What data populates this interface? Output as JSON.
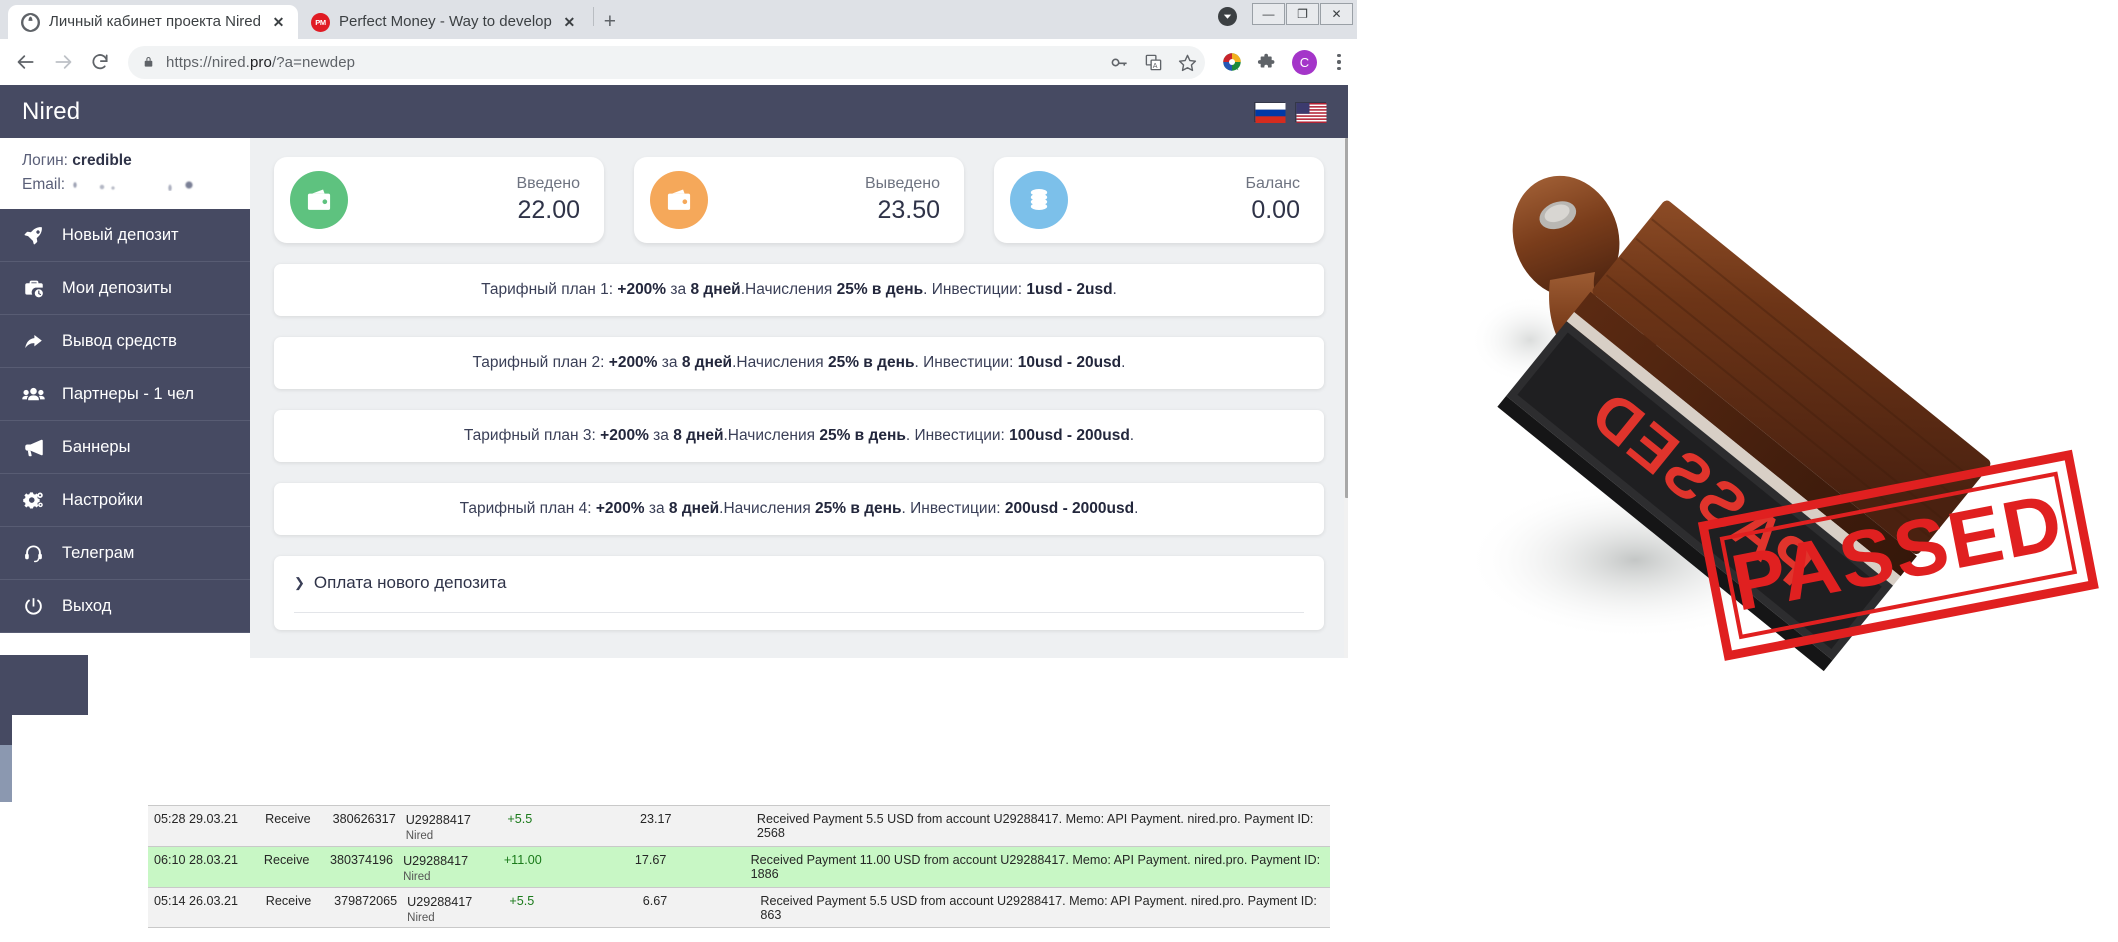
{
  "browser": {
    "tabs": [
      {
        "title": "Личный кабинет проекта Nired",
        "favicon": "globe-icon",
        "active": true,
        "close_label": "✕"
      },
      {
        "title": "Perfect Money - Way to develop",
        "favicon": "perfect-money-icon",
        "active": false,
        "close_label": "✕"
      }
    ],
    "new_tab_label": "+",
    "window_controls": {
      "minimize": "—",
      "maximize": "❐",
      "close": "✕"
    },
    "address": {
      "url_prefix": "https://nired.",
      "url_domain": "pro",
      "url_suffix": "/?a=newdep",
      "full_url": "https://nired.pro/?a=newdep",
      "lock": "lock-icon"
    },
    "nav": {
      "back": "back-arrow-icon",
      "forward": "forward-arrow-icon",
      "reload": "reload-icon"
    },
    "omni_icons": [
      "password-key-icon",
      "translate-icon",
      "bookmark-star-icon"
    ],
    "extensions": [
      "imgburn-icon",
      "puzzle-extensions-icon"
    ],
    "profile_initial": "C",
    "menu": "kebab-menu-icon"
  },
  "site": {
    "brand": "Nired",
    "languages": [
      {
        "name": "russian-flag",
        "code": "ru"
      },
      {
        "name": "us-flag",
        "code": "en"
      }
    ],
    "accent_dark": "#464a62",
    "accent_bg": "#eef0f2"
  },
  "sidebar": {
    "login_label": "Логин:",
    "login_value": "credible",
    "email_label": "Email:",
    "email_value": "",
    "items": [
      {
        "label": "Новый депозит",
        "icon": "rocket-icon"
      },
      {
        "label": "Мои депозиты",
        "icon": "briefcase-clock-icon"
      },
      {
        "label": "Вывод средств",
        "icon": "share-arrow-icon"
      },
      {
        "label": "Партнеры - 1 чел",
        "icon": "users-group-icon"
      },
      {
        "label": "Баннеры",
        "icon": "megaphone-icon"
      },
      {
        "label": "Настройки",
        "icon": "gears-icon"
      },
      {
        "label": "Телеграм",
        "icon": "headset-icon"
      },
      {
        "label": "Выход",
        "icon": "power-icon"
      }
    ]
  },
  "stats": [
    {
      "label": "Введено",
      "value": "22.00",
      "icon": "wallet-in-icon",
      "color": "#5ec27f"
    },
    {
      "label": "Выведено",
      "value": "23.50",
      "icon": "wallet-out-icon",
      "color": "#f5a85a"
    },
    {
      "label": "Баланс",
      "value": "0.00",
      "icon": "coins-icon",
      "color": "#7cc0ea"
    }
  ],
  "plans": [
    {
      "prefix": "Тарифный план 1: ",
      "percent": "+200%",
      "mid1": " за ",
      "days": "8 дней",
      "mid2": ".Начисления ",
      "rate": "25% в день",
      "mid3": ". Инвестиции: ",
      "range": "1usd - 2usd",
      "end": "."
    },
    {
      "prefix": "Тарифный план 2: ",
      "percent": "+200%",
      "mid1": " за ",
      "days": "8 дней",
      "mid2": ".Начисления ",
      "rate": "25% в день",
      "mid3": ". Инвестиции: ",
      "range": "10usd - 20usd",
      "end": "."
    },
    {
      "prefix": "Тарифный план 3: ",
      "percent": "+200%",
      "mid1": " за ",
      "days": "8 дней",
      "mid2": ".Начисления ",
      "rate": "25% в день",
      "mid3": ". Инвестиции: ",
      "range": "100usd - 200usd",
      "end": "."
    },
    {
      "prefix": "Тарифный план 4: ",
      "percent": "+200%",
      "mid1": " за ",
      "days": "8 дней",
      "mid2": ".Начисления ",
      "rate": "25% в день",
      "mid3": ". Инвестиции: ",
      "range": "200usd - 2000usd",
      "end": "."
    }
  ],
  "accordion": {
    "caret": "❯",
    "title": "Оплата нового депозита"
  },
  "transactions": {
    "rows": [
      {
        "date": "05:28 29.03.21",
        "type": "Receive",
        "batch": "380626317",
        "account": "U29288417",
        "account_sub": "Nired",
        "amount": "+5.5",
        "balance": "23.17",
        "memo": "Received Payment 5.5 USD from account U29288417. Memo: API Payment. nired.pro. Payment ID: 2568",
        "highlight": false
      },
      {
        "date": "06:10 28.03.21",
        "type": "Receive",
        "batch": "380374196",
        "account": "U29288417",
        "account_sub": "Nired",
        "amount": "+11.00",
        "balance": "17.67",
        "memo": "Received Payment 11.00 USD from account U29288417. Memo: API Payment. nired.pro. Payment ID: 1886",
        "highlight": true
      },
      {
        "date": "05:14 26.03.21",
        "type": "Receive",
        "batch": "379872065",
        "account": "U29288417",
        "account_sub": "Nired",
        "amount": "+5.5",
        "balance": "6.67",
        "memo": "Received Payment 5.5 USD from account U29288417. Memo: API Payment. nired.pro. Payment ID: 863",
        "highlight": false
      }
    ]
  },
  "stamp": {
    "name": "passed-stamp-image",
    "text": "PASSED",
    "mirror_text": "PASSED",
    "ink_color": "#e02020",
    "wood_color": "#7b3f1d"
  }
}
